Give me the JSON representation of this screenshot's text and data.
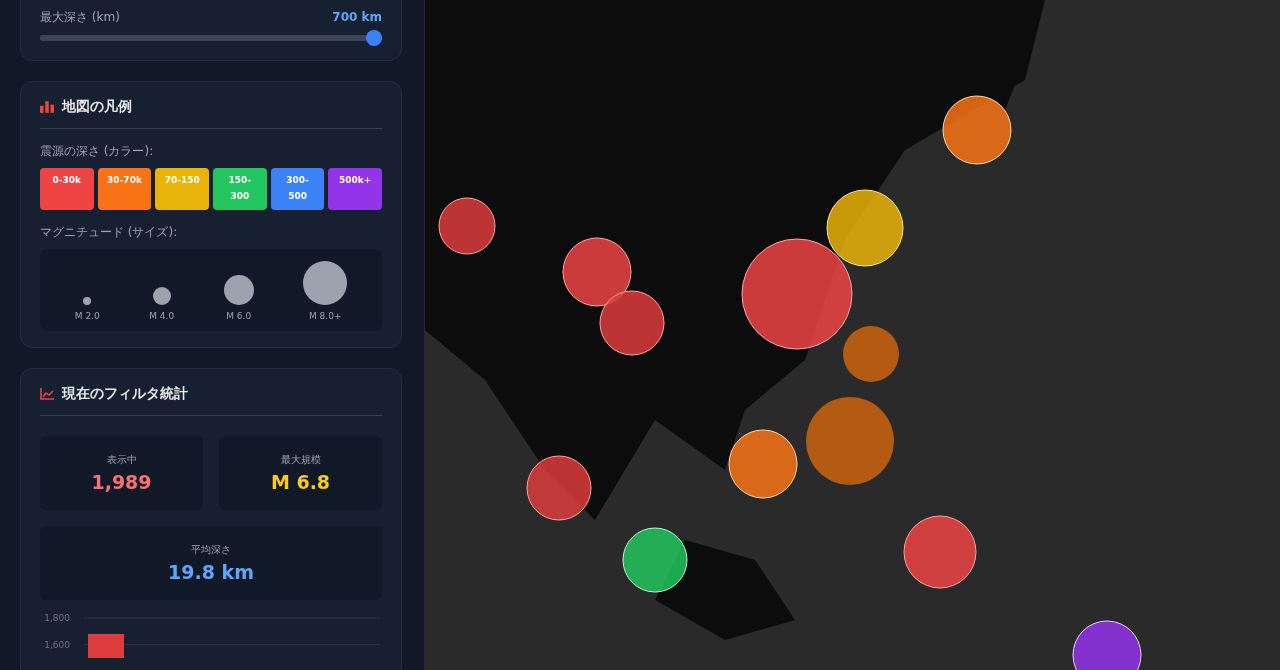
{
  "depth_filter": {
    "label": "最大深さ (km)",
    "value": "700 km",
    "level": 1
  },
  "legend": {
    "title": "地図の凡例",
    "depth_label": "震源の深さ (カラー):",
    "depth_classes": [
      {
        "label": "0-30k",
        "color": "#ef4444"
      },
      {
        "label": "30-70k",
        "color": "#f97316"
      },
      {
        "label": "70-150",
        "color": "#eab308"
      },
      {
        "label": "150-300",
        "color": "#22c55e"
      },
      {
        "label": "300-500",
        "color": "#3b82f6"
      },
      {
        "label": "500k+",
        "color": "#9333ea"
      }
    ],
    "magnitude_label": "マグニチュード (サイズ):",
    "magnitudes": [
      "M 2.0",
      "M 4.0",
      "M 6.0",
      "M 8.0+"
    ]
  },
  "stats": {
    "title": "現在のフィルタ統計",
    "cards": [
      {
        "label": "表示中",
        "value": "1,989",
        "color": "#f87171"
      },
      {
        "label": "最大規模",
        "value": "M 6.8",
        "color": "#facc15"
      },
      {
        "label": "平均深さ",
        "value": "19.8 km",
        "color": "#60a5fa"
      }
    ],
    "chart_data": {
      "type": "bar",
      "ylim": [
        1500,
        1800
      ],
      "yticks": [
        {
          "value": 1600,
          "label": "1,600"
        },
        {
          "value": 1800,
          "label": "1,800"
        }
      ],
      "series": [
        {
          "color": "#dc3c3c",
          "values": [
            1680
          ]
        }
      ]
    }
  }
}
